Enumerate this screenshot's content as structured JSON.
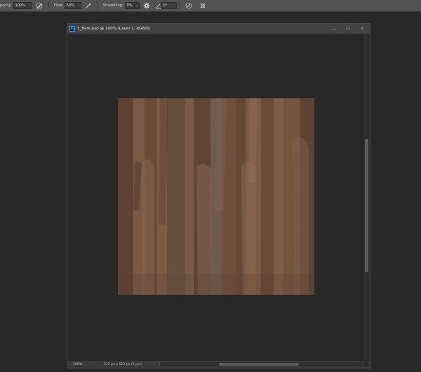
{
  "options_bar": {
    "opacity_label": "pacity:",
    "opacity_value": "100%",
    "flow_label": "Flow:",
    "flow_value": "50%",
    "smoothing_label": "Smoothing:",
    "smoothing_value": "0%",
    "angle_value": "0°"
  },
  "document": {
    "title": "T_Bark.psd @ 100% (Layer 1, RGB/8)",
    "app_badge": "Ps",
    "zoom": "100%",
    "doc_info": "512 px x 512 px (2 ppi)",
    "status_arrow": "›",
    "scroll_left_arrow": "‹"
  },
  "window_buttons": {
    "minimize": "—",
    "maximize": "☐",
    "close": "✕"
  }
}
